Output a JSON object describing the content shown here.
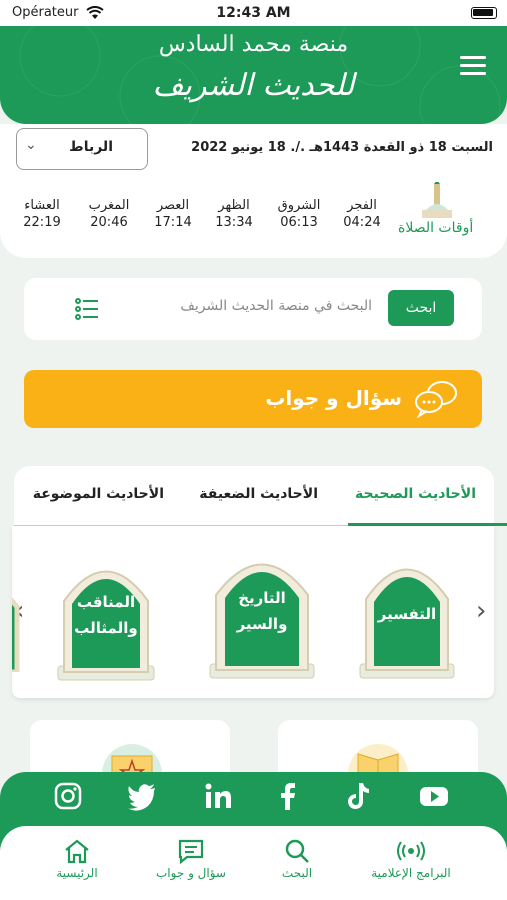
{
  "status_bar": {
    "carrier": "Opérateur",
    "time": "12:43 AM"
  },
  "header": {
    "subtitle": "منصة محمد السادس",
    "title": "للحديث الشريف"
  },
  "prayer": {
    "city": "الرباط",
    "date": "السبت 18 ذو القعدة 1443هـ ./. 18 يونيو 2022",
    "section_title": "أوقات الصلاة",
    "times": [
      {
        "name": "الفجر",
        "time": "04:24"
      },
      {
        "name": "الشروق",
        "time": "06:13"
      },
      {
        "name": "الظهر",
        "time": "13:34"
      },
      {
        "name": "العصر",
        "time": "17:14"
      },
      {
        "name": "المغرب",
        "time": "20:46"
      },
      {
        "name": "العشاء",
        "time": "22:19"
      }
    ]
  },
  "search": {
    "button": "ابحث",
    "placeholder": "البحث في منصة الحديث الشريف"
  },
  "qa_banner": {
    "label": "سؤال و جواب"
  },
  "tabs": [
    "الأحاديث الصحيحة",
    "الأحاديث الضعيفة",
    "الأحاديث الموضوعة"
  ],
  "carousel": [
    {
      "line1": "التفسير",
      "line2": ""
    },
    {
      "line1": "التاريخ",
      "line2": "والسير"
    },
    {
      "line1": "المناقب",
      "line2": "والمثالب"
    }
  ],
  "social": [
    "instagram",
    "twitter",
    "linkedin",
    "facebook",
    "tiktok",
    "youtube"
  ],
  "nav": [
    {
      "label": "البرامج الإعلامية"
    },
    {
      "label": "البحث"
    },
    {
      "label": "سؤال و جواب"
    },
    {
      "label": "الرئيسية"
    }
  ],
  "colors": {
    "primary": "#1d9a57",
    "accent": "#f9b116"
  }
}
